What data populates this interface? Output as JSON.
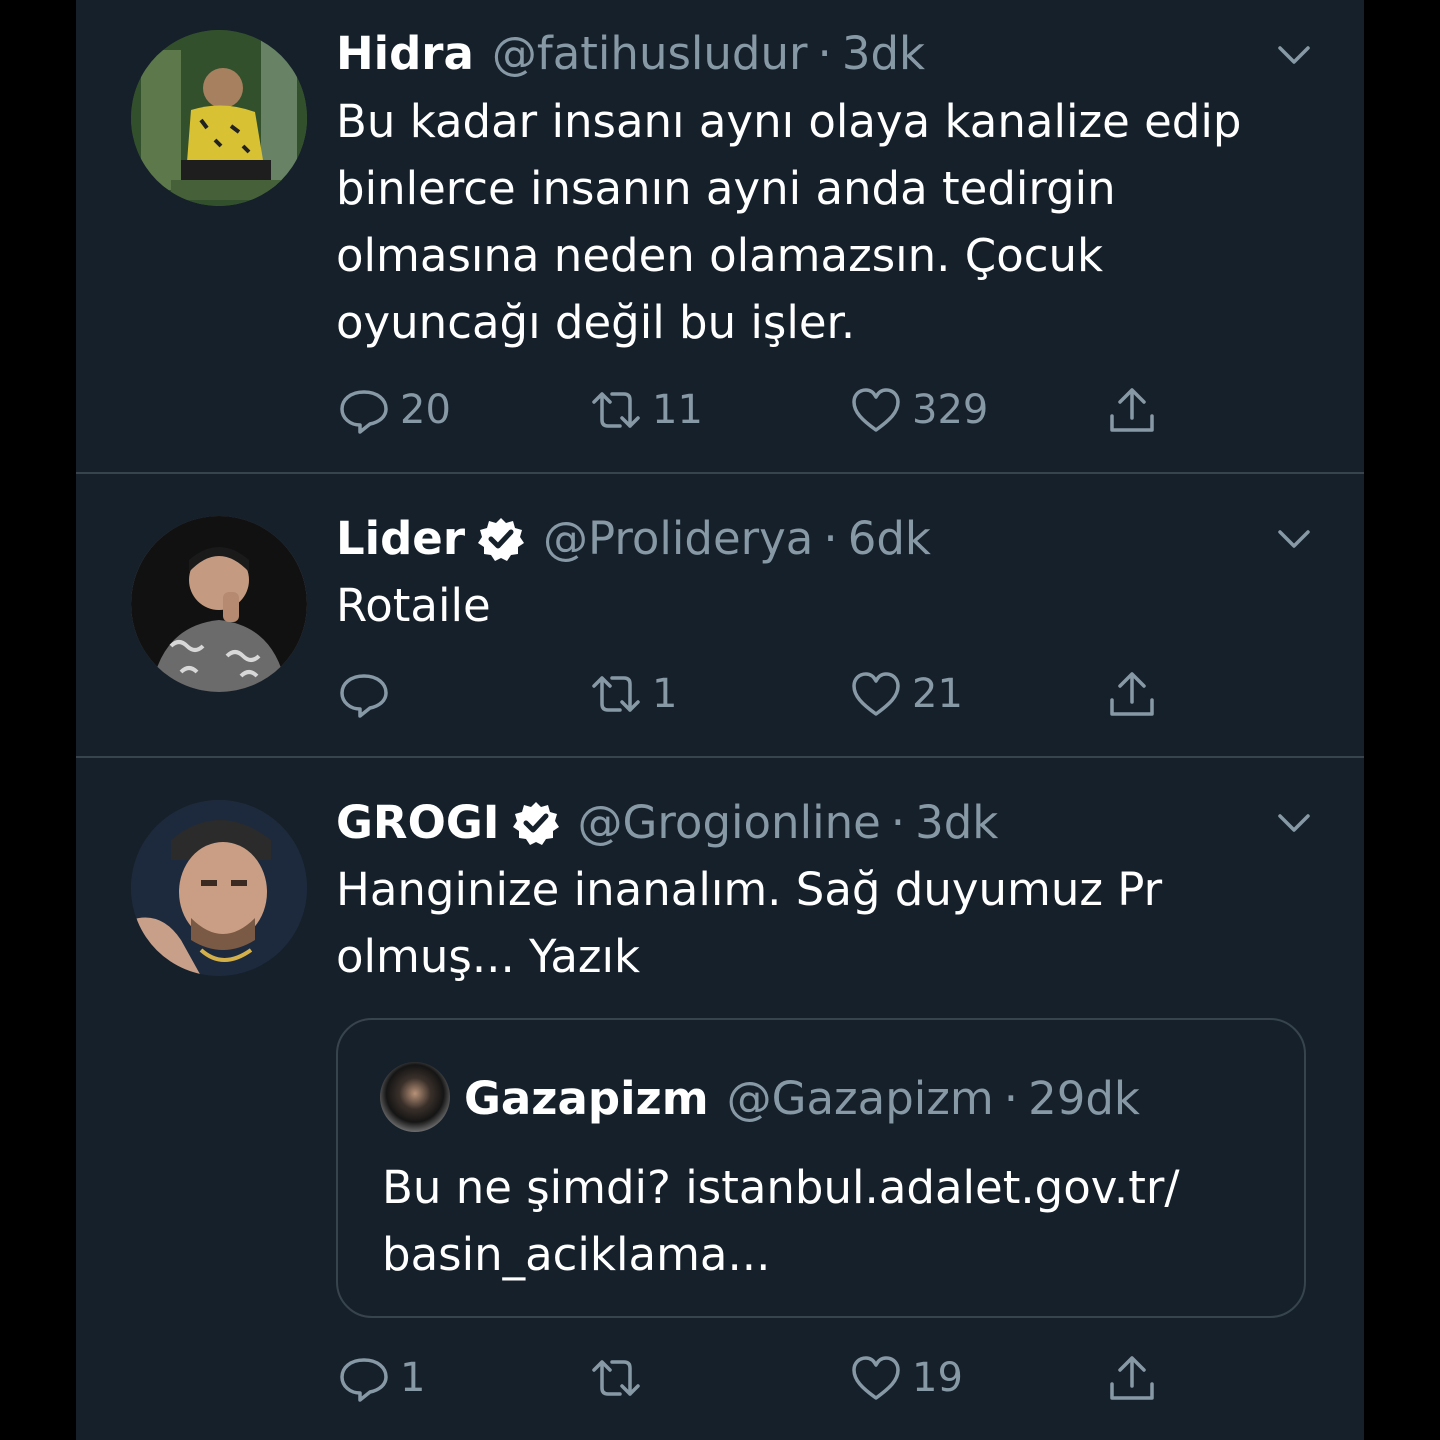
{
  "tweets": [
    {
      "name": "Hidra",
      "verified": false,
      "handle": "@fatihusludur",
      "separator": "·",
      "time": "3dk",
      "lines": [
        "Bu kadar insanı aynı olaya kanalize edip",
        "binlerce insanın ayni anda tedirgin",
        "olmasına neden olamazsın. Çocuk",
        "oyuncağı değil bu işler."
      ],
      "replies": "20",
      "retweets": "11",
      "likes": "329"
    },
    {
      "name": "Lider",
      "verified": true,
      "handle": "@Proliderya",
      "separator": "·",
      "time": "6dk",
      "lines": [
        "Rotaile"
      ],
      "replies": "",
      "retweets": "1",
      "likes": "21"
    },
    {
      "name": "GROGI",
      "verified": true,
      "handle": "@Grogionline",
      "separator": "·",
      "time": "3dk",
      "lines": [
        "Hanginize inanalım. Sağ duyumuz Pr",
        "olmuş... Yazık"
      ],
      "replies": "1",
      "retweets": "",
      "likes": "19",
      "quote": {
        "name": "Gazapizm",
        "handle": "@Gazapizm",
        "separator": "·",
        "time": "29dk",
        "lines": [
          "Bu ne şimdi? istanbul.adalet.gov.tr/",
          "basin_aciklama..."
        ]
      }
    }
  ],
  "colors": {
    "background": "#15202b",
    "outer": "#000000",
    "text": "#ffffff",
    "muted": "#8899a6",
    "divider": "#38444d"
  },
  "icons": [
    "reply-icon",
    "retweet-icon",
    "like-icon",
    "share-icon",
    "chevron-down-icon",
    "verified-badge-icon"
  ]
}
